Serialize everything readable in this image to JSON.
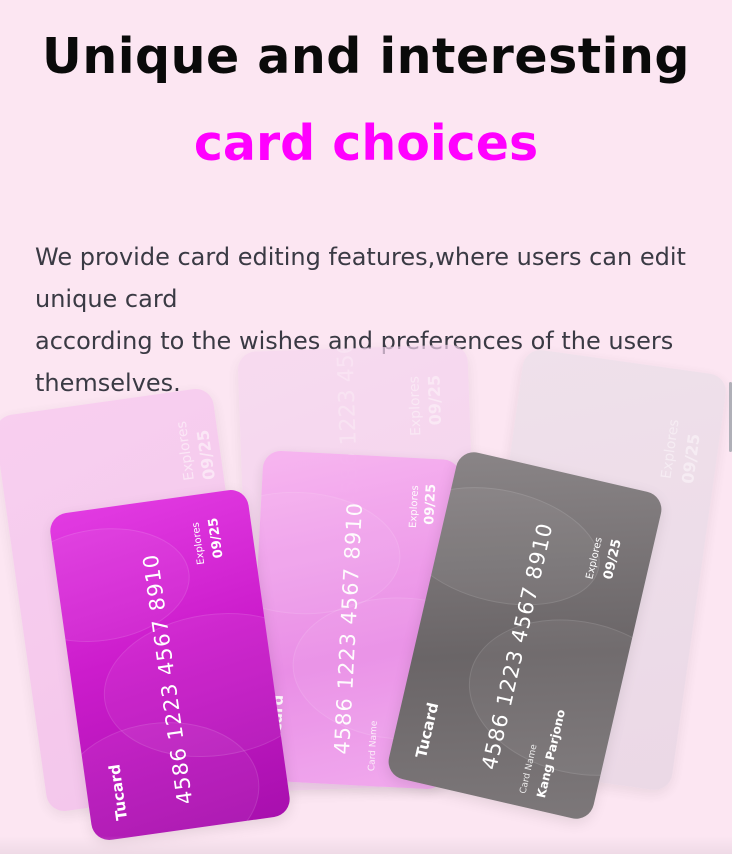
{
  "heading": "Unique and interesting",
  "subheading": "card choices",
  "description": {
    "line1": "We provide card editing features,where users can edit",
    "line2": "unique card",
    "line3": "according to the wishes and preferences of the users",
    "line4": "themselves."
  },
  "card": {
    "brand": "Tucard",
    "number": "4586 1223 4567 8910",
    "expiry_label": "Explores",
    "expiry": "09/25",
    "name_label": "Card Name",
    "holder": "Kang Parjono"
  },
  "colors": {
    "heading": "#0a0a0a",
    "accent": "#ff00ff",
    "background": "#fce6f2",
    "card_magenta": "#d41fd8",
    "card_pink": "#f2a3ec",
    "card_gray": "#6e6a6c"
  }
}
